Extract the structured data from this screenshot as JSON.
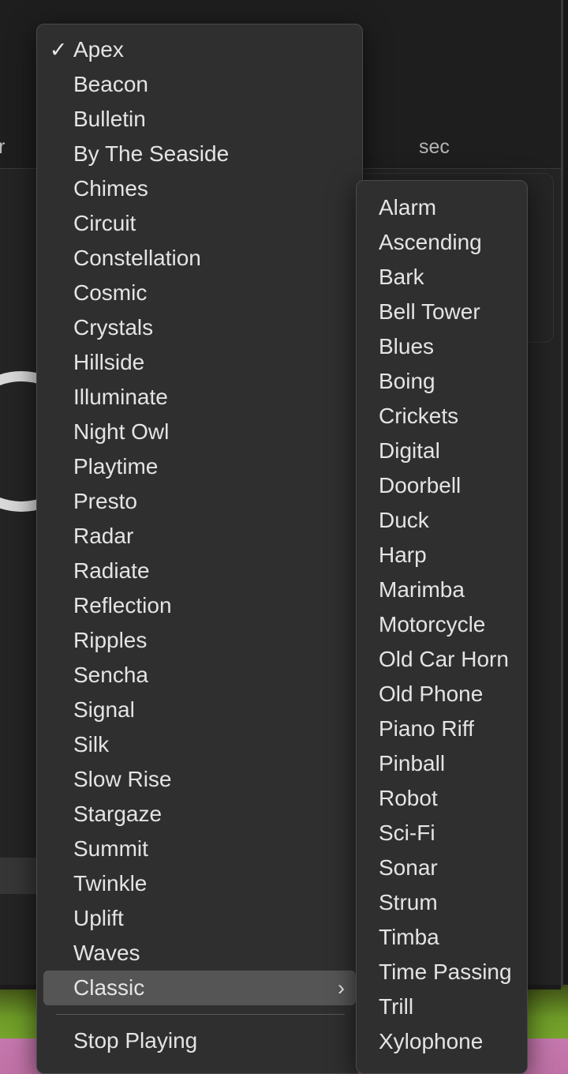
{
  "background": {
    "window_label_left": "ar",
    "window_label_seconds": "sec",
    "timer_ring": "progress-ring",
    "wallpaper_colors": [
      "#6e9b28",
      "#c578ae"
    ],
    "window_bg": "#222222"
  },
  "main_menu": {
    "name": "sound-picker-menu",
    "selected_item": "Apex",
    "checkmark_glyph": "✓",
    "items": [
      {
        "label": "Apex",
        "checked": true
      },
      {
        "label": "Beacon",
        "checked": false
      },
      {
        "label": "Bulletin",
        "checked": false
      },
      {
        "label": "By The Seaside",
        "checked": false
      },
      {
        "label": "Chimes",
        "checked": false
      },
      {
        "label": "Circuit",
        "checked": false
      },
      {
        "label": "Constellation",
        "checked": false
      },
      {
        "label": "Cosmic",
        "checked": false
      },
      {
        "label": "Crystals",
        "checked": false
      },
      {
        "label": "Hillside",
        "checked": false
      },
      {
        "label": "Illuminate",
        "checked": false
      },
      {
        "label": "Night Owl",
        "checked": false
      },
      {
        "label": "Playtime",
        "checked": false
      },
      {
        "label": "Presto",
        "checked": false
      },
      {
        "label": "Radar",
        "checked": false
      },
      {
        "label": "Radiate",
        "checked": false
      },
      {
        "label": "Reflection",
        "checked": false
      },
      {
        "label": "Ripples",
        "checked": false
      },
      {
        "label": "Sencha",
        "checked": false
      },
      {
        "label": "Signal",
        "checked": false
      },
      {
        "label": "Silk",
        "checked": false
      },
      {
        "label": "Slow Rise",
        "checked": false
      },
      {
        "label": "Stargaze",
        "checked": false
      },
      {
        "label": "Summit",
        "checked": false
      },
      {
        "label": "Twinkle",
        "checked": false
      },
      {
        "label": "Uplift",
        "checked": false
      },
      {
        "label": "Waves",
        "checked": false
      }
    ],
    "submenu_item": {
      "label": "Classic",
      "highlighted": true,
      "arrow_glyph": "›"
    },
    "footer_item": {
      "label": "Stop Playing"
    },
    "highlight_color": "#555555",
    "panel_color": "#2f2f2f"
  },
  "sub_menu": {
    "name": "classic-sounds-submenu",
    "items": [
      {
        "label": "Alarm"
      },
      {
        "label": "Ascending"
      },
      {
        "label": "Bark"
      },
      {
        "label": "Bell Tower"
      },
      {
        "label": "Blues"
      },
      {
        "label": "Boing"
      },
      {
        "label": "Crickets"
      },
      {
        "label": "Digital"
      },
      {
        "label": "Doorbell"
      },
      {
        "label": "Duck"
      },
      {
        "label": "Harp"
      },
      {
        "label": "Marimba"
      },
      {
        "label": "Motorcycle"
      },
      {
        "label": "Old Car Horn"
      },
      {
        "label": "Old Phone"
      },
      {
        "label": "Piano Riff"
      },
      {
        "label": "Pinball"
      },
      {
        "label": "Robot"
      },
      {
        "label": "Sci-Fi"
      },
      {
        "label": "Sonar"
      },
      {
        "label": "Strum"
      },
      {
        "label": "Timba"
      },
      {
        "label": "Time Passing"
      },
      {
        "label": "Trill"
      },
      {
        "label": "Xylophone"
      }
    ]
  }
}
